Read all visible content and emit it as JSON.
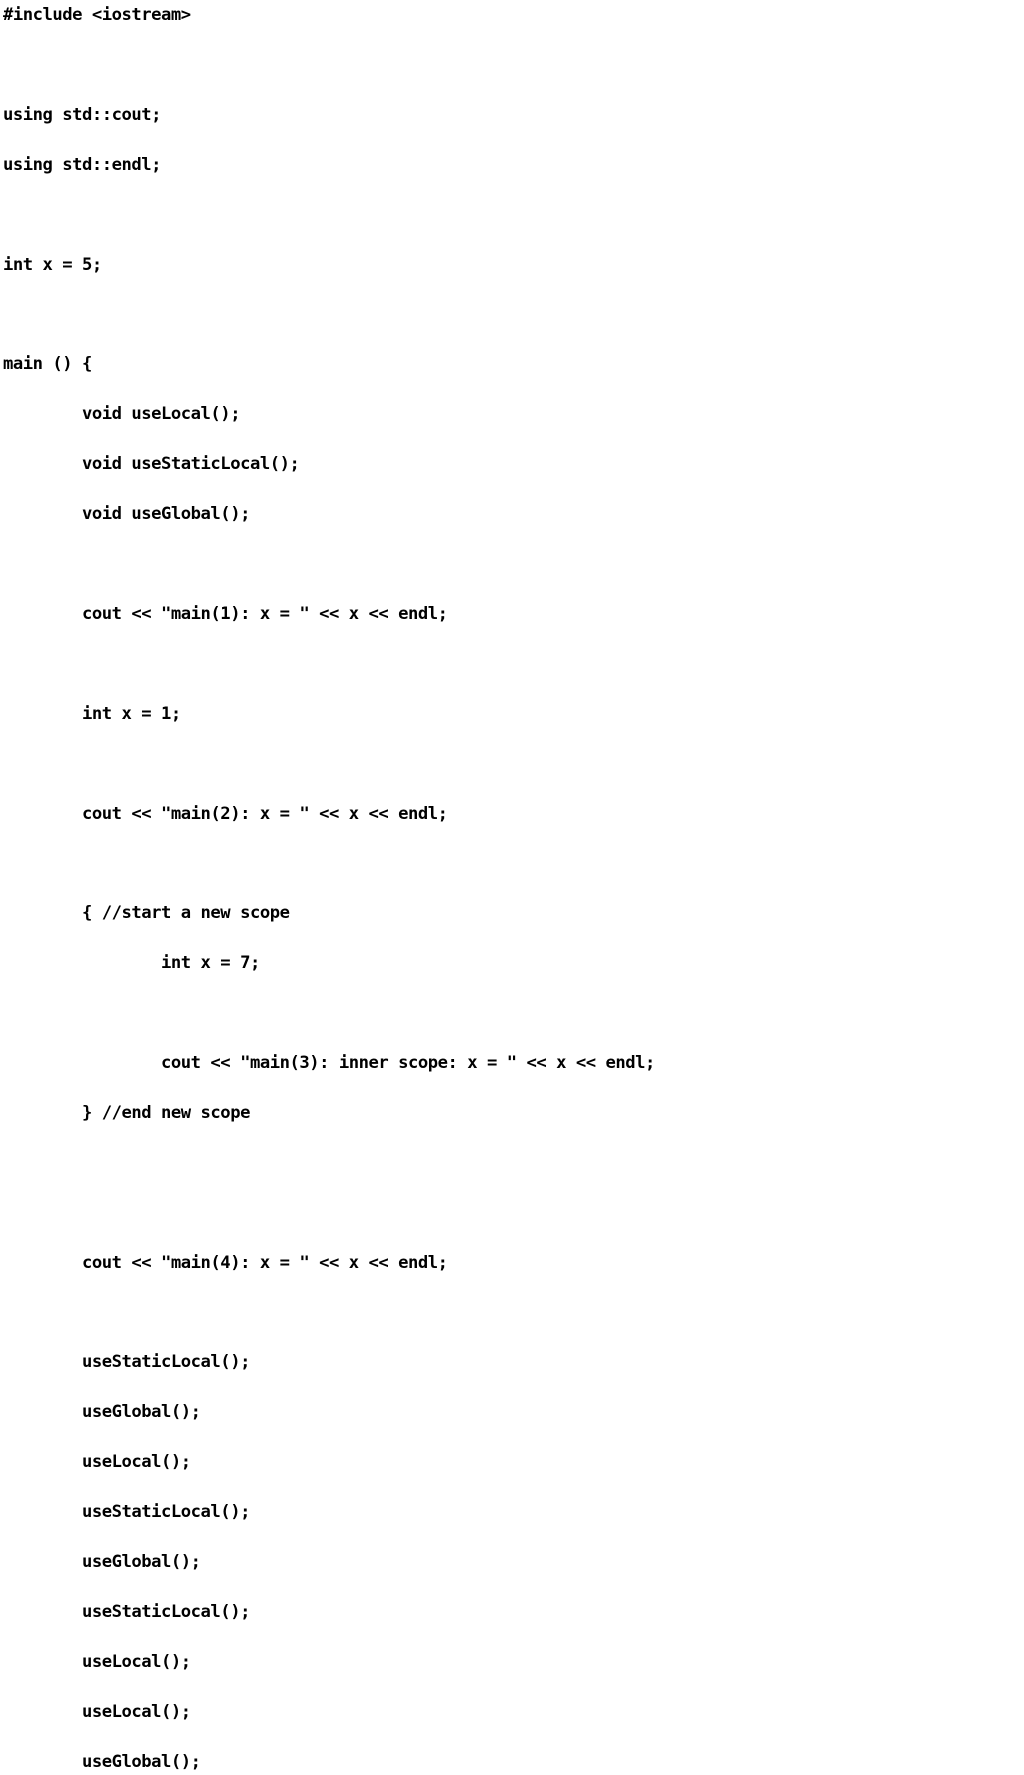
{
  "document": {
    "kind": "source-code-listing",
    "language": "C++",
    "background_color": "#ffffff",
    "text_color": "#000000"
  },
  "code": {
    "lines": [
      "#include <iostream>",
      "",
      "using std::cout;",
      "using std::endl;",
      "",
      "int x = 5;",
      "",
      "main () {",
      "        void useLocal();",
      "        void useStaticLocal();",
      "        void useGlobal();",
      "",
      "        cout << \"main(1): x = \" << x << endl;",
      "",
      "        int x = 1;",
      "",
      "        cout << \"main(2): x = \" << x << endl;",
      "",
      "        { //start a new scope",
      "                int x = 7;",
      "",
      "                cout << \"main(3): inner scope: x = \" << x << endl;",
      "        } //end new scope",
      "",
      "",
      "        cout << \"main(4): x = \" << x << endl;",
      "",
      "        useStaticLocal();",
      "        useGlobal();",
      "        useLocal();",
      "        useStaticLocal();",
      "        useGlobal();",
      "        useStaticLocal();",
      "        useLocal();",
      "        useLocal();",
      "        useGlobal();"
    ]
  }
}
